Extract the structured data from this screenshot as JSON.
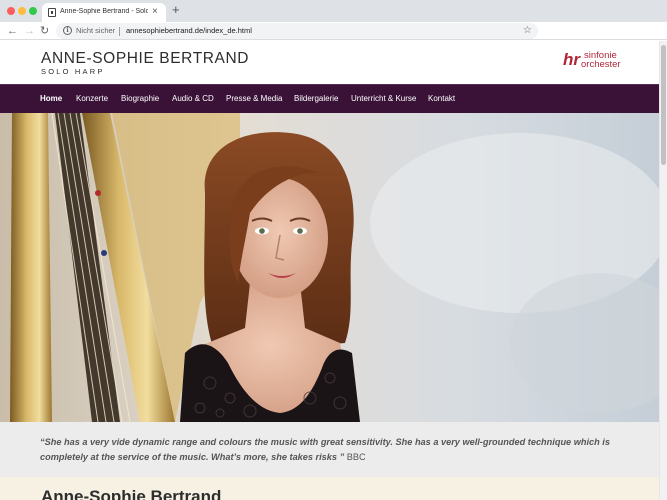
{
  "browser": {
    "tab_title": "Anne-Sophie Bertrand - Solo Harp",
    "tab_close": "×",
    "new_tab": "+",
    "security_label": "Nicht sicher",
    "url": "annesophiebertrand.de/index_de.html",
    "back_glyph": "←",
    "forward_glyph": "→",
    "reload_glyph": "↻",
    "info_glyph": "i",
    "star_glyph": "☆"
  },
  "site": {
    "title": "ANNE-SOPHIE BERTRAND",
    "subtitle": "SOLO HARP",
    "partner_logo": {
      "mark": "hr",
      "line1": "sinfonie",
      "line2": "orchester",
      "color": "#b0273a"
    }
  },
  "nav": {
    "items": [
      {
        "label": "Home",
        "active": true
      },
      {
        "label": "Konzerte"
      },
      {
        "label": "Biographie"
      },
      {
        "label": "Audio & CD"
      },
      {
        "label": "Presse & Media"
      },
      {
        "label": "Bildergalerie"
      },
      {
        "label": "Unterricht & Kurse"
      },
      {
        "label": "Kontakt"
      }
    ],
    "background": "#3a1238"
  },
  "quote": {
    "text": "“She has a very vide dynamic range and colours the music with great sensitivity. She has a very well-grounded technique which is completely at the service of the music. What’s more, she takes risks ”",
    "source": "BBC"
  },
  "section": {
    "heading": "Anne-Sophie Bertrand"
  }
}
